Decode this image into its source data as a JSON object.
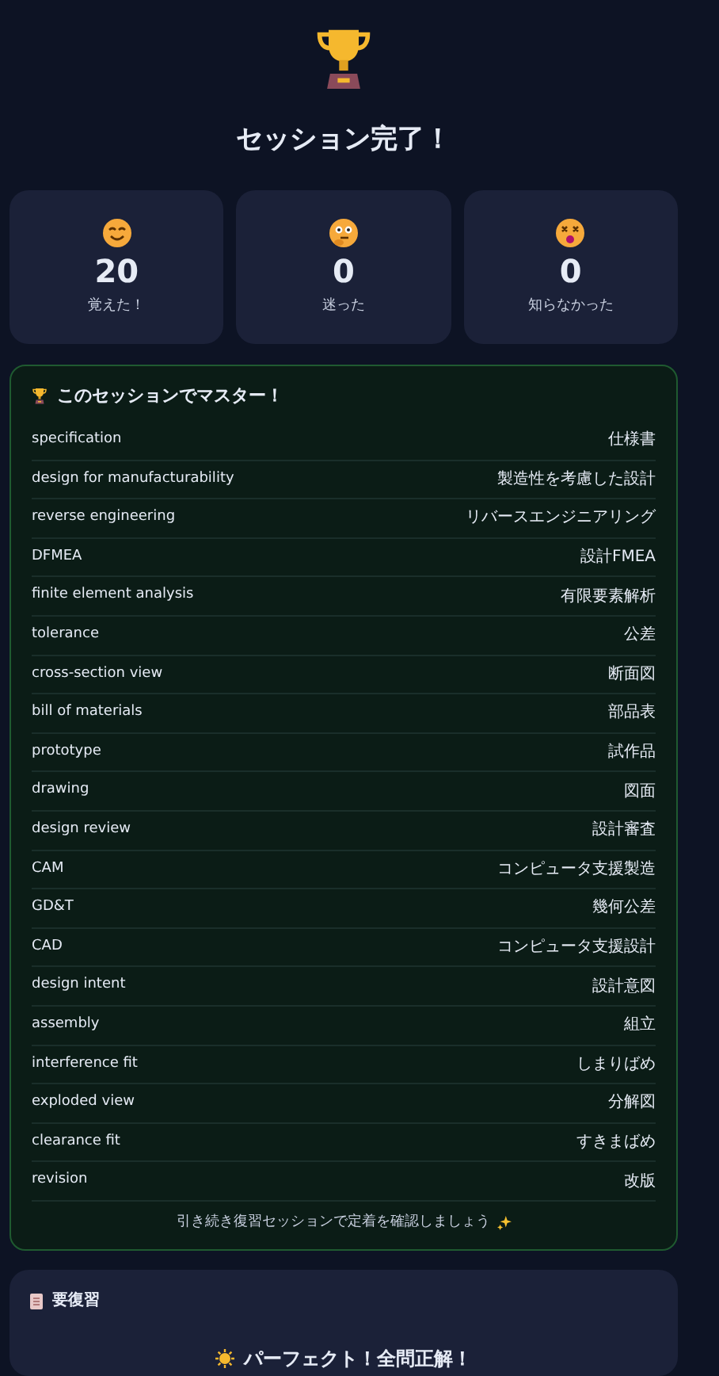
{
  "title": "セッション完了！",
  "stats": [
    {
      "kind": "happy",
      "value": "20",
      "label": "覚えた！"
    },
    {
      "kind": "thinking",
      "value": "0",
      "label": "迷った"
    },
    {
      "kind": "dizzy",
      "value": "0",
      "label": "知らなかった"
    }
  ],
  "mastered": {
    "title": "このセッションでマスター！",
    "rows": [
      {
        "term": "specification",
        "meaning": "仕様書"
      },
      {
        "term": "design for manufacturability",
        "meaning": "製造性を考慮した設計"
      },
      {
        "term": "reverse engineering",
        "meaning": "リバースエンジニアリング"
      },
      {
        "term": "DFMEA",
        "meaning": "設計FMEA"
      },
      {
        "term": "finite element analysis",
        "meaning": "有限要素解析"
      },
      {
        "term": "tolerance",
        "meaning": "公差"
      },
      {
        "term": "cross-section view",
        "meaning": "断面図"
      },
      {
        "term": "bill of materials",
        "meaning": "部品表"
      },
      {
        "term": "prototype",
        "meaning": "試作品"
      },
      {
        "term": "drawing",
        "meaning": "図面"
      },
      {
        "term": "design review",
        "meaning": "設計審査"
      },
      {
        "term": "CAM",
        "meaning": "コンピュータ支援製造"
      },
      {
        "term": "GD&T",
        "meaning": "幾何公差"
      },
      {
        "term": "CAD",
        "meaning": "コンピュータ支援設計"
      },
      {
        "term": "design intent",
        "meaning": "設計意図"
      },
      {
        "term": "assembly",
        "meaning": "組立"
      },
      {
        "term": "interference fit",
        "meaning": "しまりばめ"
      },
      {
        "term": "exploded view",
        "meaning": "分解図"
      },
      {
        "term": "clearance fit",
        "meaning": "すきまばめ"
      },
      {
        "term": "revision",
        "meaning": "改版"
      }
    ],
    "note": "引き続き復習セッションで定着を確認しましょう"
  },
  "review": {
    "title": "要復習",
    "message": "パーフェクト！全問正解！"
  }
}
